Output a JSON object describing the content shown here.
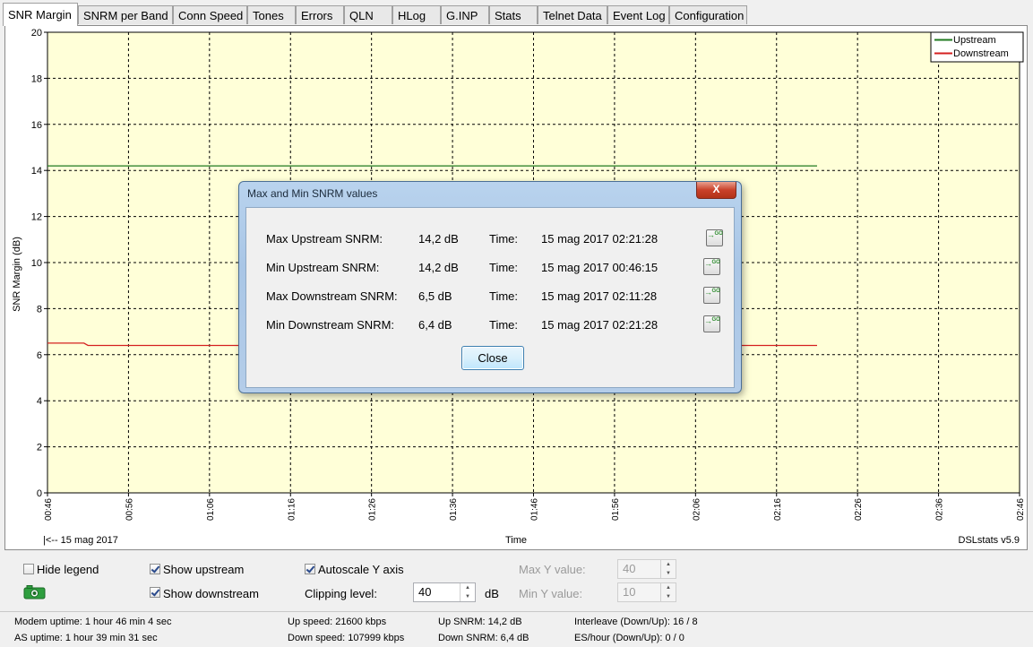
{
  "tabs": [
    {
      "label": "SNR Margin",
      "active": true
    },
    {
      "label": "SNRM per Band"
    },
    {
      "label": "Conn Speed"
    },
    {
      "label": "Tones"
    },
    {
      "label": "Errors"
    },
    {
      "label": "QLN"
    },
    {
      "label": "HLog"
    },
    {
      "label": "G.INP"
    },
    {
      "label": "Stats"
    },
    {
      "label": "Telnet Data"
    },
    {
      "label": "Event Log"
    },
    {
      "label": "Configuration"
    }
  ],
  "chart_data": {
    "type": "line",
    "ylabel": "SNR Margin (dB)",
    "xlabel": "Time",
    "ylim": [
      0,
      20
    ],
    "yticks": [
      "0",
      "2",
      "4",
      "6",
      "8",
      "10",
      "12",
      "14",
      "16",
      "18",
      "20"
    ],
    "xticks": [
      "00:46",
      "00:56",
      "01:06",
      "01:16",
      "01:26",
      "01:36",
      "01:46",
      "01:56",
      "02:06",
      "02:16",
      "02:26",
      "02:36",
      "02:46"
    ],
    "x_minutes_range": [
      0,
      120
    ],
    "grid": true,
    "background": "#ffffd8",
    "legend_position": "top-right",
    "series": [
      {
        "name": "Upstream",
        "color": "#1f7a1f",
        "points": [
          [
            0,
            14.2
          ],
          [
            95,
            14.2
          ]
        ]
      },
      {
        "name": "Downstream",
        "color": "#d42020",
        "points": [
          [
            0,
            6.5
          ],
          [
            4.5,
            6.5
          ],
          [
            5,
            6.4
          ],
          [
            95,
            6.4
          ]
        ]
      }
    ],
    "date_label": "|<-- 15 mag 2017",
    "version_label": "DSLstats v5.9"
  },
  "dialog": {
    "title": "Max and Min SNRM values",
    "close_x": "X",
    "time_label": "Time:",
    "go_label": "GO",
    "rows": [
      {
        "label": "Max Upstream SNRM:",
        "value": "14,2 dB",
        "time": "15 mag 2017 02:21:28"
      },
      {
        "label": "Min Upstream SNRM:",
        "value": "14,2 dB",
        "time": "15 mag 2017 00:46:15"
      },
      {
        "label": "Max Downstream SNRM:",
        "value": "6,5 dB",
        "time": "15 mag 2017 02:11:28"
      },
      {
        "label": "Min Downstream SNRM:",
        "value": "6,4 dB",
        "time": "15 mag 2017 02:21:28"
      }
    ],
    "close_button": "Close"
  },
  "controls": {
    "hide_legend": {
      "label": "Hide legend",
      "checked": false
    },
    "show_upstream": {
      "label": "Show upstream",
      "checked": true
    },
    "show_downstream": {
      "label": "Show downstream",
      "checked": true
    },
    "autoscale_y": {
      "label": "Autoscale Y axis",
      "checked": true
    },
    "clipping_level": {
      "label": "Clipping level:",
      "value": "40",
      "unit": "dB"
    },
    "max_y": {
      "label": "Max Y value:",
      "value": "40"
    },
    "min_y": {
      "label": "Min Y value:",
      "value": "10"
    }
  },
  "status": {
    "modem_uptime": "Modem uptime:  1 hour 46 min 4 sec",
    "as_uptime": "AS uptime:  1 hour 39 min 31 sec",
    "up_speed": "Up speed: 21600 kbps",
    "down_speed": "Down speed: 107999 kbps",
    "up_snrm": "Up SNRM: 14,2 dB",
    "down_snrm": "Down SNRM: 6,4 dB",
    "interleave": "Interleave (Down/Up): 16 / 8",
    "es_hour": "ES/hour (Down/Up): 0 / 0"
  }
}
